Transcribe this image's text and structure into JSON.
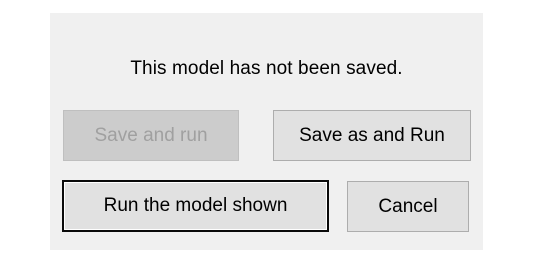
{
  "dialog": {
    "message": "This model has not been saved.",
    "buttons": {
      "save_and_run": "Save and run",
      "save_as_and_run": "Save as and Run",
      "run_model_shown": "Run the model shown",
      "cancel": "Cancel"
    },
    "states": {
      "save_and_run": "disabled",
      "run_model_shown": "default"
    }
  }
}
